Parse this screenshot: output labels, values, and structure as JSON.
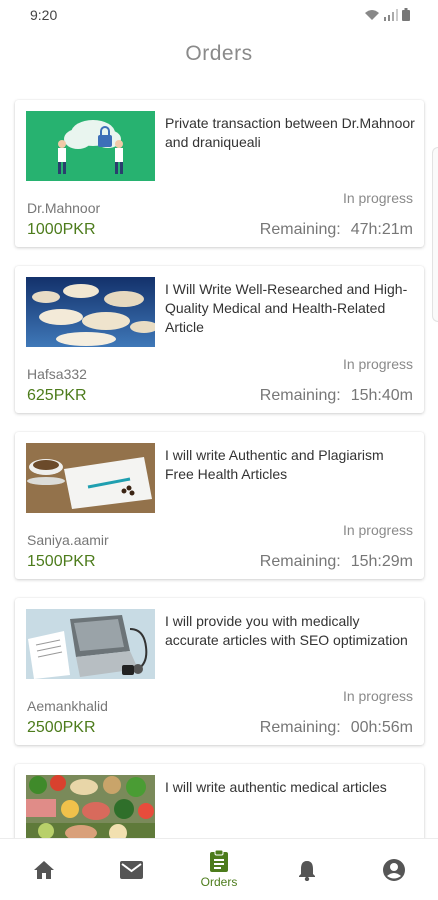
{
  "status_bar": {
    "time": "9:20"
  },
  "page": {
    "title": "Orders"
  },
  "orders": [
    {
      "title": "Private transaction between Dr.Mahnoor and draniqueali",
      "seller": "Dr.Mahnoor",
      "price": "1000PKR",
      "status": "In progress",
      "remaining_label": "Remaining:",
      "remaining_time": "47h:21m",
      "thumbnail": "security-illustration"
    },
    {
      "title": "I Will Write Well-Researched and High-Quality Medical and Health-Related Article",
      "seller": "Hafsa332",
      "price": "625PKR",
      "status": "In progress",
      "remaining_label": "Remaining:",
      "remaining_time": "15h:40m",
      "thumbnail": "sky-clouds"
    },
    {
      "title": "I will write Authentic and Plagiarism Free Health Articles",
      "seller": "Saniya.aamir",
      "price": "1500PKR",
      "status": "In progress",
      "remaining_label": "Remaining:",
      "remaining_time": "15h:29m",
      "thumbnail": "coffee-desk"
    },
    {
      "title": "I will provide you with medically accurate articles with SEO optimization",
      "seller": "Aemankhalid",
      "price": "2500PKR",
      "status": "In progress",
      "remaining_label": "Remaining:",
      "remaining_time": "00h:56m",
      "thumbnail": "medical-laptop"
    },
    {
      "title": "I will write authentic medical articles",
      "seller": "",
      "price": "",
      "status": "",
      "remaining_label": "",
      "remaining_time": "",
      "thumbnail": "healthy-food"
    }
  ],
  "bottom_nav": {
    "items": [
      {
        "icon": "home-icon",
        "label": ""
      },
      {
        "icon": "mail-icon",
        "label": ""
      },
      {
        "icon": "orders-clipboard-icon",
        "label": "Orders",
        "active": true
      },
      {
        "icon": "bell-icon",
        "label": ""
      },
      {
        "icon": "profile-icon",
        "label": ""
      }
    ]
  },
  "colors": {
    "accent": "#4d7c1c",
    "inactive_icon": "#555555",
    "title_gray": "#8a8a8a"
  }
}
